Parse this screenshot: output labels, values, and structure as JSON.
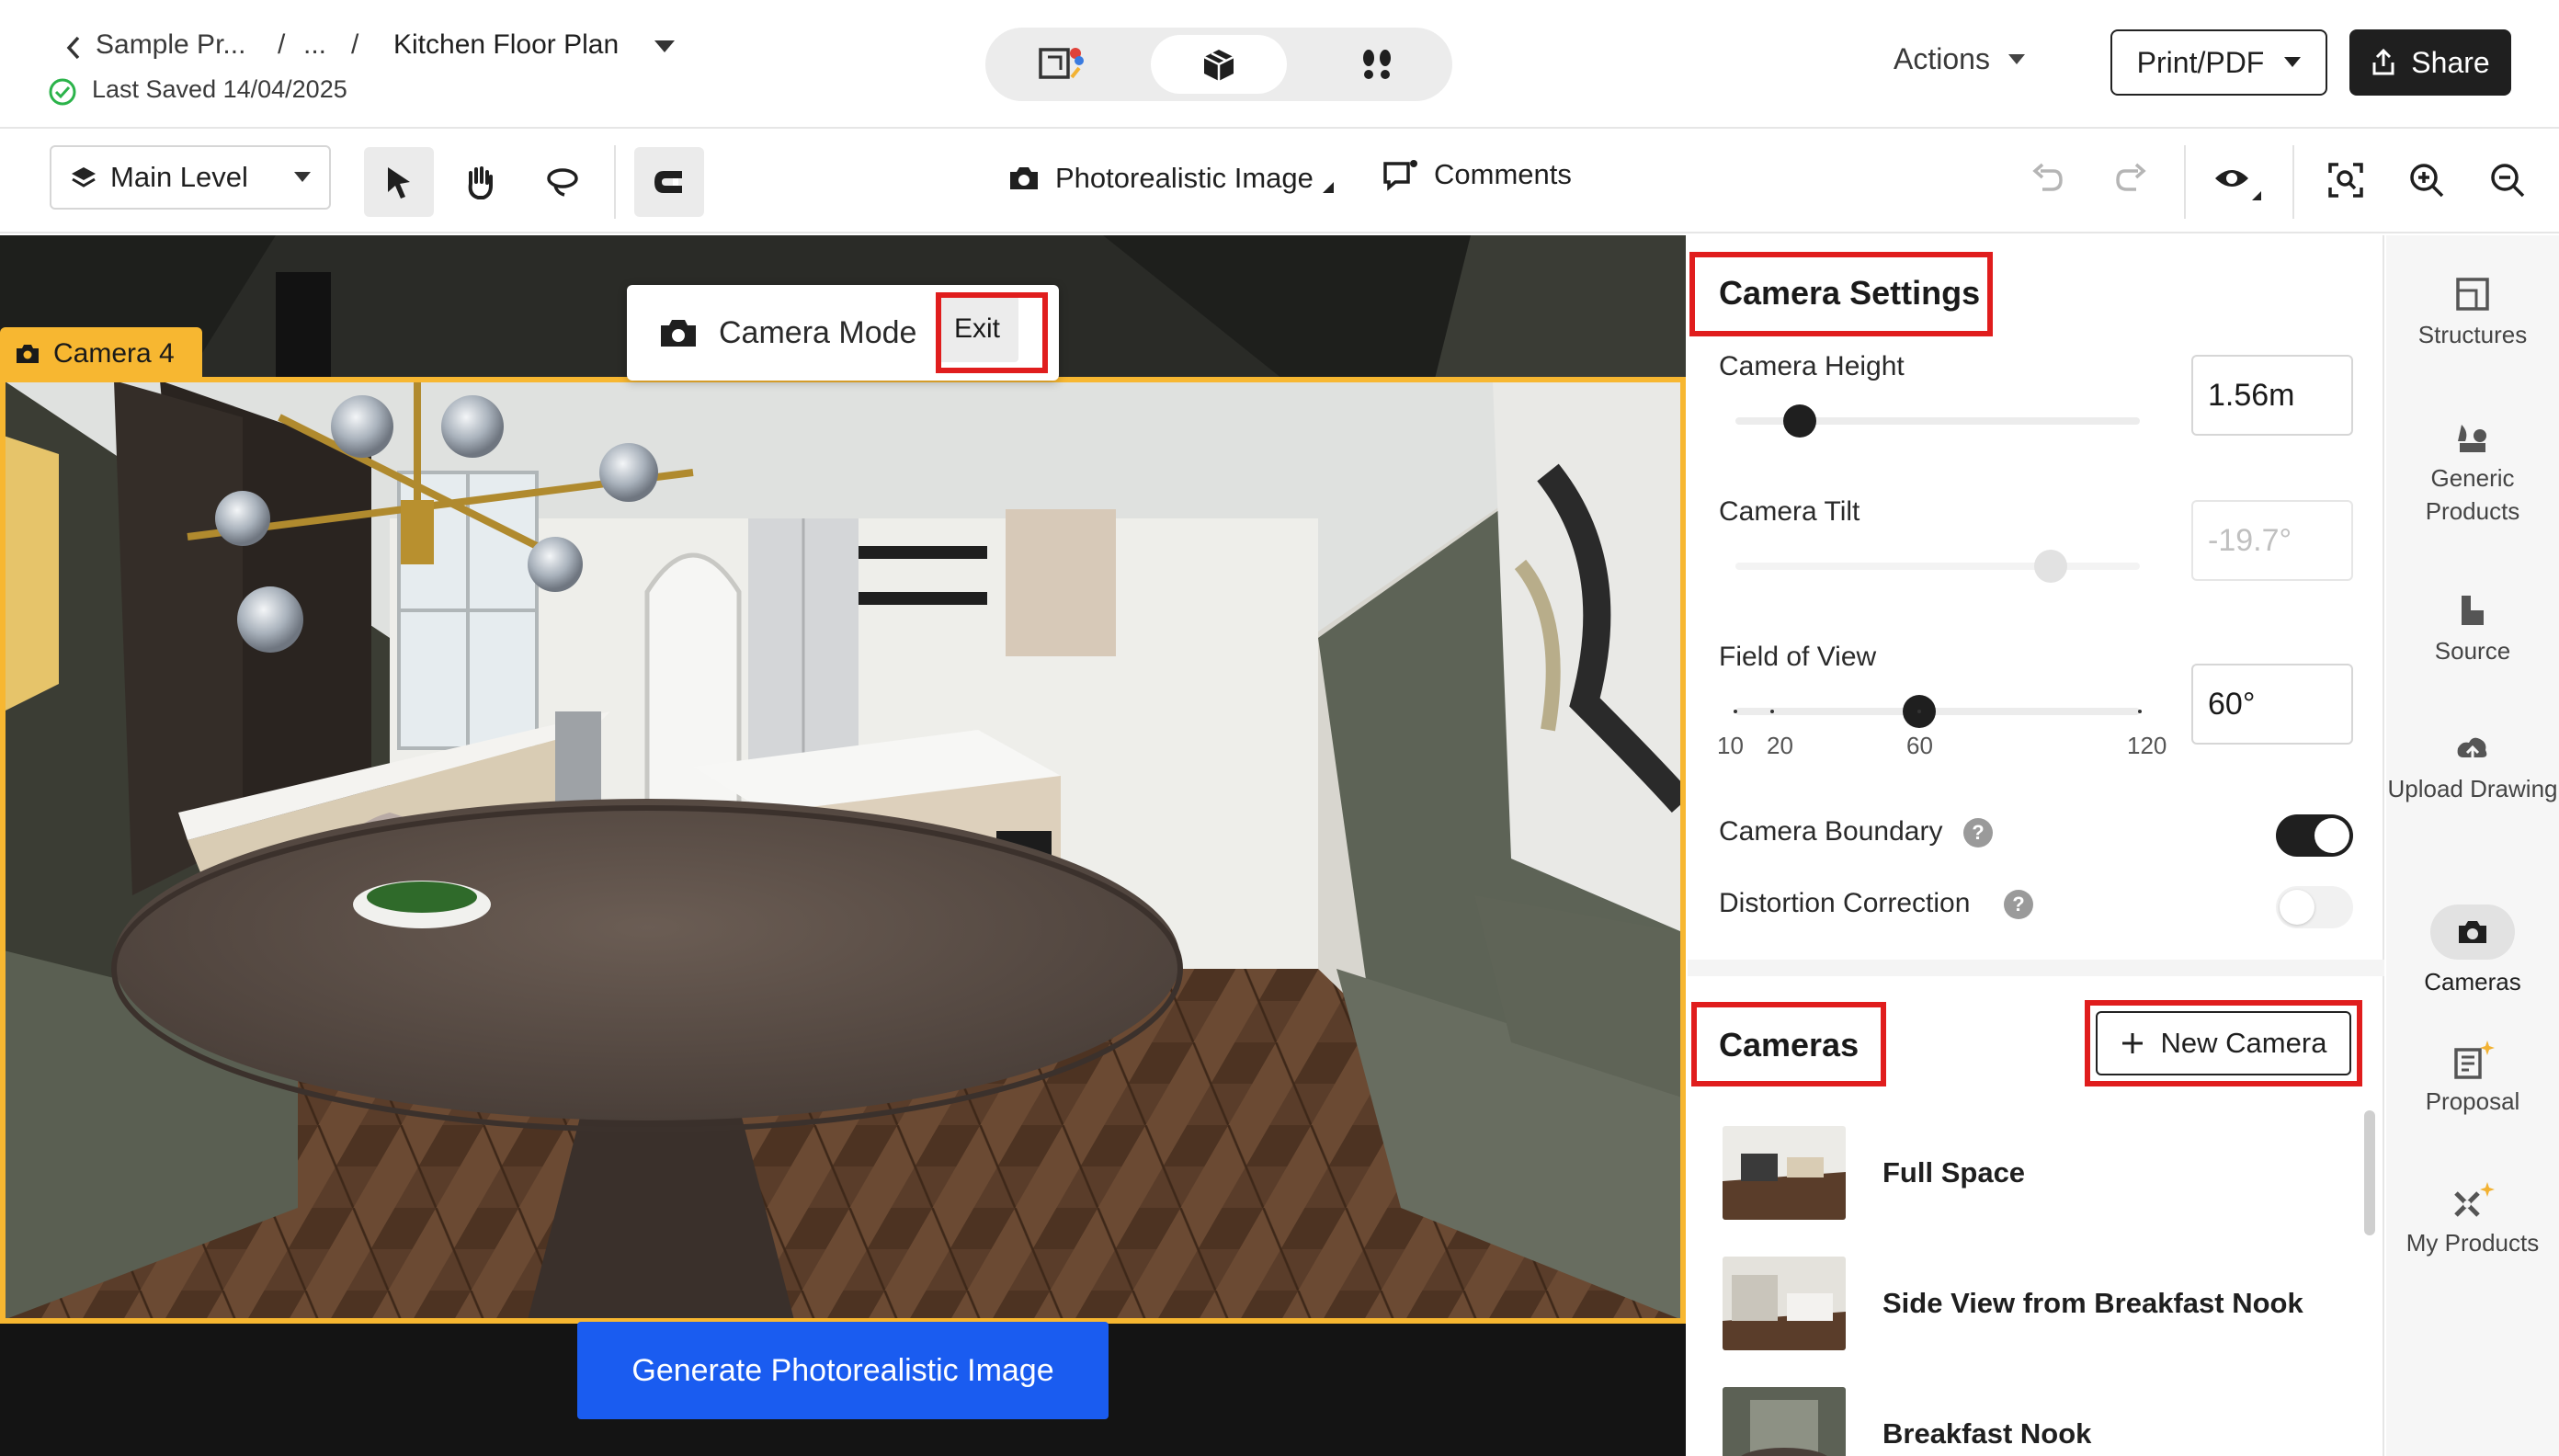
{
  "header": {
    "back_label": "Sample Pr...",
    "ellipsis": "...",
    "sep": "/",
    "plan_title": "Kitchen Floor Plan",
    "saved_status": "Last Saved 14/04/2025",
    "actions_label": "Actions",
    "print_label": "Print/PDF",
    "share_label": "Share",
    "view_modes": [
      "2d-plan-icon",
      "3d-box-icon",
      "walkthrough-icon"
    ]
  },
  "toolbar": {
    "level_label": "Main Level",
    "photo_label": "Photorealistic Image",
    "comments_label": "Comments"
  },
  "viewport": {
    "camera_tag": "Camera 4",
    "camera_mode_label": "Camera Mode",
    "exit_label": "Exit",
    "generate_label": "Generate Photorealistic Image"
  },
  "settings": {
    "title": "Camera Settings",
    "height": {
      "label": "Camera Height",
      "value": "1.56m",
      "fraction": 0.16
    },
    "tilt": {
      "label": "Camera Tilt",
      "value": "-19.7°",
      "fraction": 0.78
    },
    "fov": {
      "label": "Field of View",
      "value": "60°",
      "ticks": [
        "10",
        "20",
        "60",
        "120"
      ],
      "value_num": 60,
      "min": 10,
      "max": 120
    },
    "boundary": {
      "label": "Camera Boundary",
      "on": true
    },
    "distortion": {
      "label": "Distortion Correction",
      "on": false
    },
    "help_glyph": "?"
  },
  "cameras": {
    "title": "Cameras",
    "new_label": "New Camera",
    "items": [
      {
        "name": "Full Space"
      },
      {
        "name": "Side View from Breakfast Nook"
      },
      {
        "name": "Breakfast Nook"
      }
    ]
  },
  "rail": {
    "items": [
      {
        "label": "Structures",
        "icon": "structures-icon"
      },
      {
        "label": "Generic Products",
        "icon": "generic-products-icon"
      },
      {
        "label": "Source",
        "icon": "source-icon"
      },
      {
        "label": "Upload Drawing",
        "icon": "upload-drawing-icon"
      },
      {
        "label": "Cameras",
        "icon": "cameras-icon",
        "active": true
      },
      {
        "label": "Proposal",
        "icon": "proposal-icon"
      },
      {
        "label": "My Products",
        "icon": "my-products-icon"
      }
    ]
  },
  "colors": {
    "accent_camera": "#f7b731",
    "highlight": "#e01d1d",
    "generate_blue": "#1a5cf0",
    "saved_green": "#2bb34a"
  }
}
